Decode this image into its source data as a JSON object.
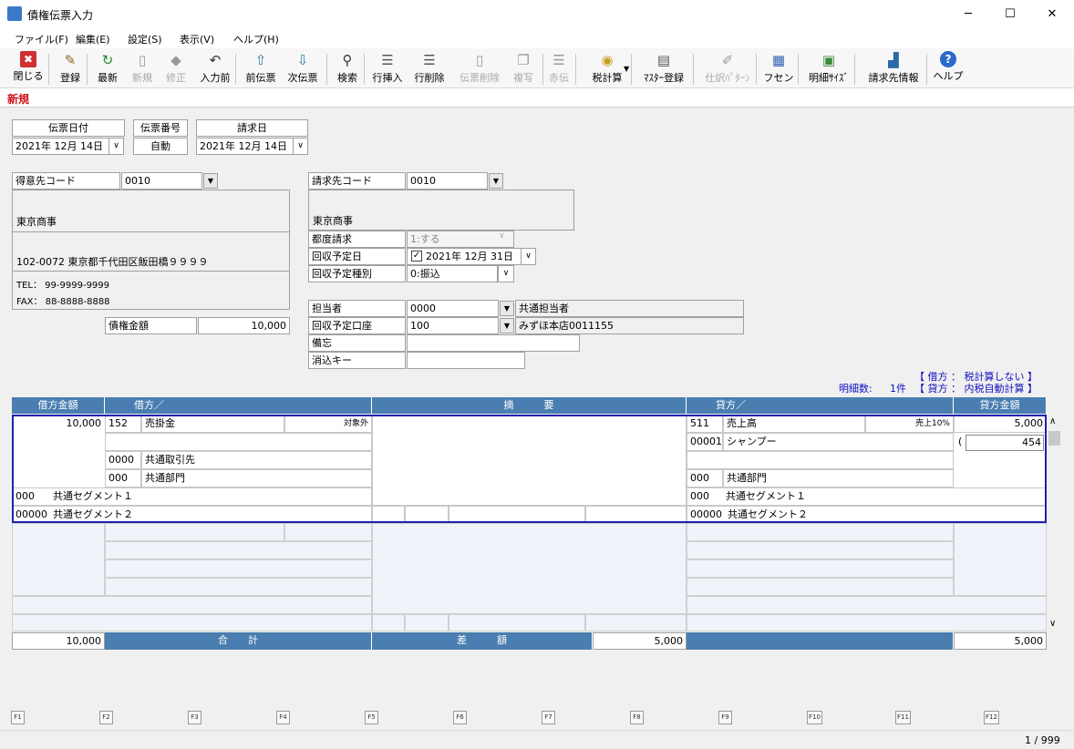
{
  "window": {
    "title": "債権伝票入力",
    "minimize": "─",
    "maximize": "☐",
    "close": "✕"
  },
  "menu": [
    "ファイル(F)",
    "編集(E)",
    "設定(S)",
    "表示(V)",
    "ヘルプ(H)"
  ],
  "toolbar": [
    {
      "label": "閉じる",
      "icon": "close-icon",
      "glyph": "✖",
      "color": "#d03030",
      "enabled": true
    },
    {
      "label": "登録",
      "icon": "register-icon",
      "glyph": "✎",
      "color": "#8a6a20",
      "enabled": true
    },
    {
      "label": "最新",
      "icon": "refresh-icon",
      "glyph": "↻",
      "color": "#2a8a2a",
      "enabled": true
    },
    {
      "label": "新規",
      "icon": "new-icon",
      "glyph": "▯",
      "color": "#999",
      "enabled": false
    },
    {
      "label": "修正",
      "icon": "edit-icon",
      "glyph": "◆",
      "color": "#999",
      "enabled": false
    },
    {
      "label": "入力前",
      "icon": "undo-icon",
      "glyph": "↶",
      "color": "#333",
      "enabled": true
    },
    {
      "label": "前伝票",
      "icon": "prev-slip-icon",
      "glyph": "⇧",
      "color": "#2a7aa8",
      "enabled": true
    },
    {
      "label": "次伝票",
      "icon": "next-slip-icon",
      "glyph": "⇩",
      "color": "#2a7aa8",
      "enabled": true
    },
    {
      "label": "検索",
      "icon": "search-icon",
      "glyph": "⚲",
      "color": "#333",
      "enabled": true
    },
    {
      "label": "行挿入",
      "icon": "insert-row-icon",
      "glyph": "☰",
      "color": "#555",
      "enabled": true
    },
    {
      "label": "行削除",
      "icon": "delete-row-icon",
      "glyph": "☰",
      "color": "#555",
      "enabled": true
    },
    {
      "label": "伝票削除",
      "icon": "delete-slip-icon",
      "glyph": "▯",
      "color": "#999",
      "enabled": false
    },
    {
      "label": "複写",
      "icon": "copy-icon",
      "glyph": "❐",
      "color": "#999",
      "enabled": false
    },
    {
      "label": "赤伝",
      "icon": "red-slip-icon",
      "glyph": "☰",
      "color": "#999",
      "enabled": false
    },
    {
      "label": "税計算",
      "icon": "tax-calc-icon",
      "glyph": "◉",
      "color": "#c8a020",
      "enabled": true
    },
    {
      "label": "ﾏｽﾀｰ登録",
      "icon": "master-icon",
      "glyph": "▤",
      "color": "#555",
      "enabled": true
    },
    {
      "label": "仕訳ﾊﾟﾀｰﾝ",
      "icon": "pattern-icon",
      "glyph": "✐",
      "color": "#999",
      "enabled": false
    },
    {
      "label": "フセン",
      "icon": "sticky-icon",
      "glyph": "▦",
      "color": "#3060b0",
      "enabled": true
    },
    {
      "label": "明細ｻｲｽﾞ",
      "icon": "detail-size-icon",
      "glyph": "▣",
      "color": "#3a8a3a",
      "enabled": true
    },
    {
      "label": "請求先情報",
      "icon": "billing-info-icon",
      "glyph": "▟",
      "color": "#2a6aa8",
      "enabled": true
    },
    {
      "label": "ヘルプ",
      "icon": "help-icon",
      "glyph": "?",
      "color": "#fff",
      "enabled": true
    }
  ],
  "tab": "新規",
  "header": {
    "slip_date_label": "伝票日付",
    "slip_date": "2021年 12月 14日",
    "slip_no_label": "伝票番号",
    "slip_no": "自動",
    "bill_date_label": "請求日",
    "bill_date": "2021年 12月 14日"
  },
  "customer": {
    "code_label": "得意先コード",
    "code": "0010",
    "name": "東京商事",
    "address": "102-0072 東京都千代田区飯田橋９９９９",
    "tel": "TEL： 99-9999-9999",
    "fax": "FAX： 88-8888-8888",
    "amount_label": "債権金額",
    "amount": "10,000"
  },
  "billing": {
    "code_label": "請求先コード",
    "code": "0010",
    "name": "東京商事",
    "each_label": "都度請求",
    "each": "1:する",
    "due_label": "回収予定日",
    "due": "2021年 12月 31日",
    "type_label": "回収予定種別",
    "type": "0:振込",
    "staff_label": "担当者",
    "staff_code": "0000",
    "staff_name": "共通担当者",
    "account_label": "回収予定口座",
    "account_code": "100",
    "account_name": "みずほ本店0011155",
    "memo_label": "備忘",
    "memo": "",
    "clear_label": "消込キー",
    "clear": ""
  },
  "tax_info": {
    "line1": "【 借方 ： 税計算しない 】",
    "count_label": "明細数:",
    "count": "1件",
    "line2": "【 貸方 ： 内税自動計算 】"
  },
  "grid": {
    "headers": [
      "借方金額",
      "借方／",
      "摘　　　要",
      "貸方／",
      "貸方金額"
    ],
    "debit_amount": "10,000",
    "debit_account_code": "152",
    "debit_account": "売掛金",
    "debit_tax": "対象外",
    "debit_partner_code": "0000",
    "debit_partner": "共通取引先",
    "debit_dept_code": "000",
    "debit_dept": "共通部門",
    "debit_seg1_code": "000",
    "debit_seg1": "共通セグメント１",
    "debit_seg2_code": "00000",
    "debit_seg2": "共通セグメント２",
    "credit_account_code": "511",
    "credit_account": "売上高",
    "credit_tax": "売上10%",
    "credit_amount": "5,000",
    "credit_item_code": "00001",
    "credit_item": "シャンプー",
    "tax_paren": "(",
    "tax_amount": "454",
    "credit_dept_code": "000",
    "credit_dept": "共通部門",
    "credit_seg1_code": "000",
    "credit_seg1": "共通セグメント１",
    "credit_seg2_code": "00000",
    "credit_seg2": "共通セグメント２"
  },
  "totals": {
    "debit_total": "10,000",
    "total_label": "合　　計",
    "diff_label": "差　　　額",
    "diff": "5,000",
    "credit_total": "5,000"
  },
  "fkeys": [
    "F1",
    "F2",
    "F3",
    "F4",
    "F5",
    "F6",
    "F7",
    "F8",
    "F9",
    "F10",
    "F11",
    "F12"
  ],
  "status": "1 / 999"
}
